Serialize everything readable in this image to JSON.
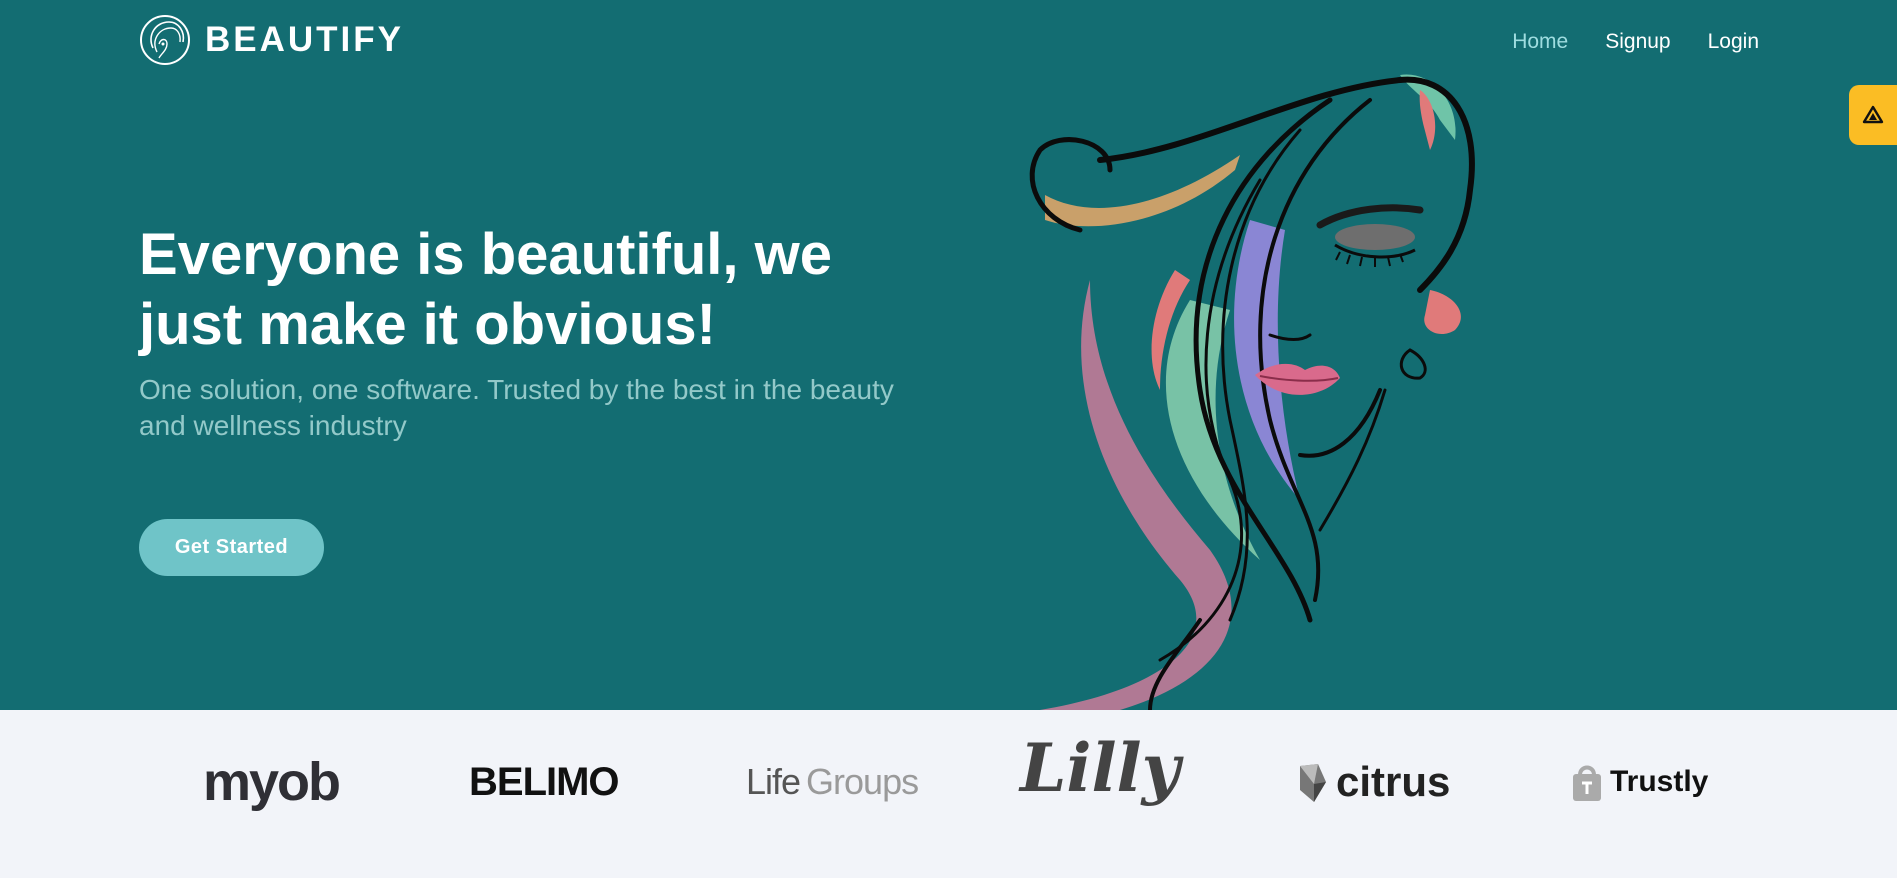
{
  "brand": {
    "name": "BEAUTIFY",
    "logo_icon": "woman-profile-circle-icon"
  },
  "nav": {
    "items": [
      {
        "label": "Home",
        "active": true
      },
      {
        "label": "Signup",
        "active": false
      },
      {
        "label": "Login",
        "active": false
      }
    ]
  },
  "hero": {
    "headline": "Everyone is beautiful, we just make it obvious!",
    "subheadline": "One solution, one software. Trusted by the best in the beauty and wellness industry",
    "cta_label": "Get Started",
    "illustration": "woman-face-line-art"
  },
  "partners": {
    "myob": "myob",
    "belimo": "BELIMO",
    "lifegroups_a": "Life",
    "lifegroups_b": "Groups",
    "lilly": "Lilly",
    "citrus": "citrus",
    "trustly": "Trustly"
  },
  "colors": {
    "hero_bg": "#136d72",
    "accent": "#6fc4c8",
    "nav_active": "#9fdde0",
    "widget": "#fbbd24",
    "strip_bg": "#f2f4f9"
  }
}
